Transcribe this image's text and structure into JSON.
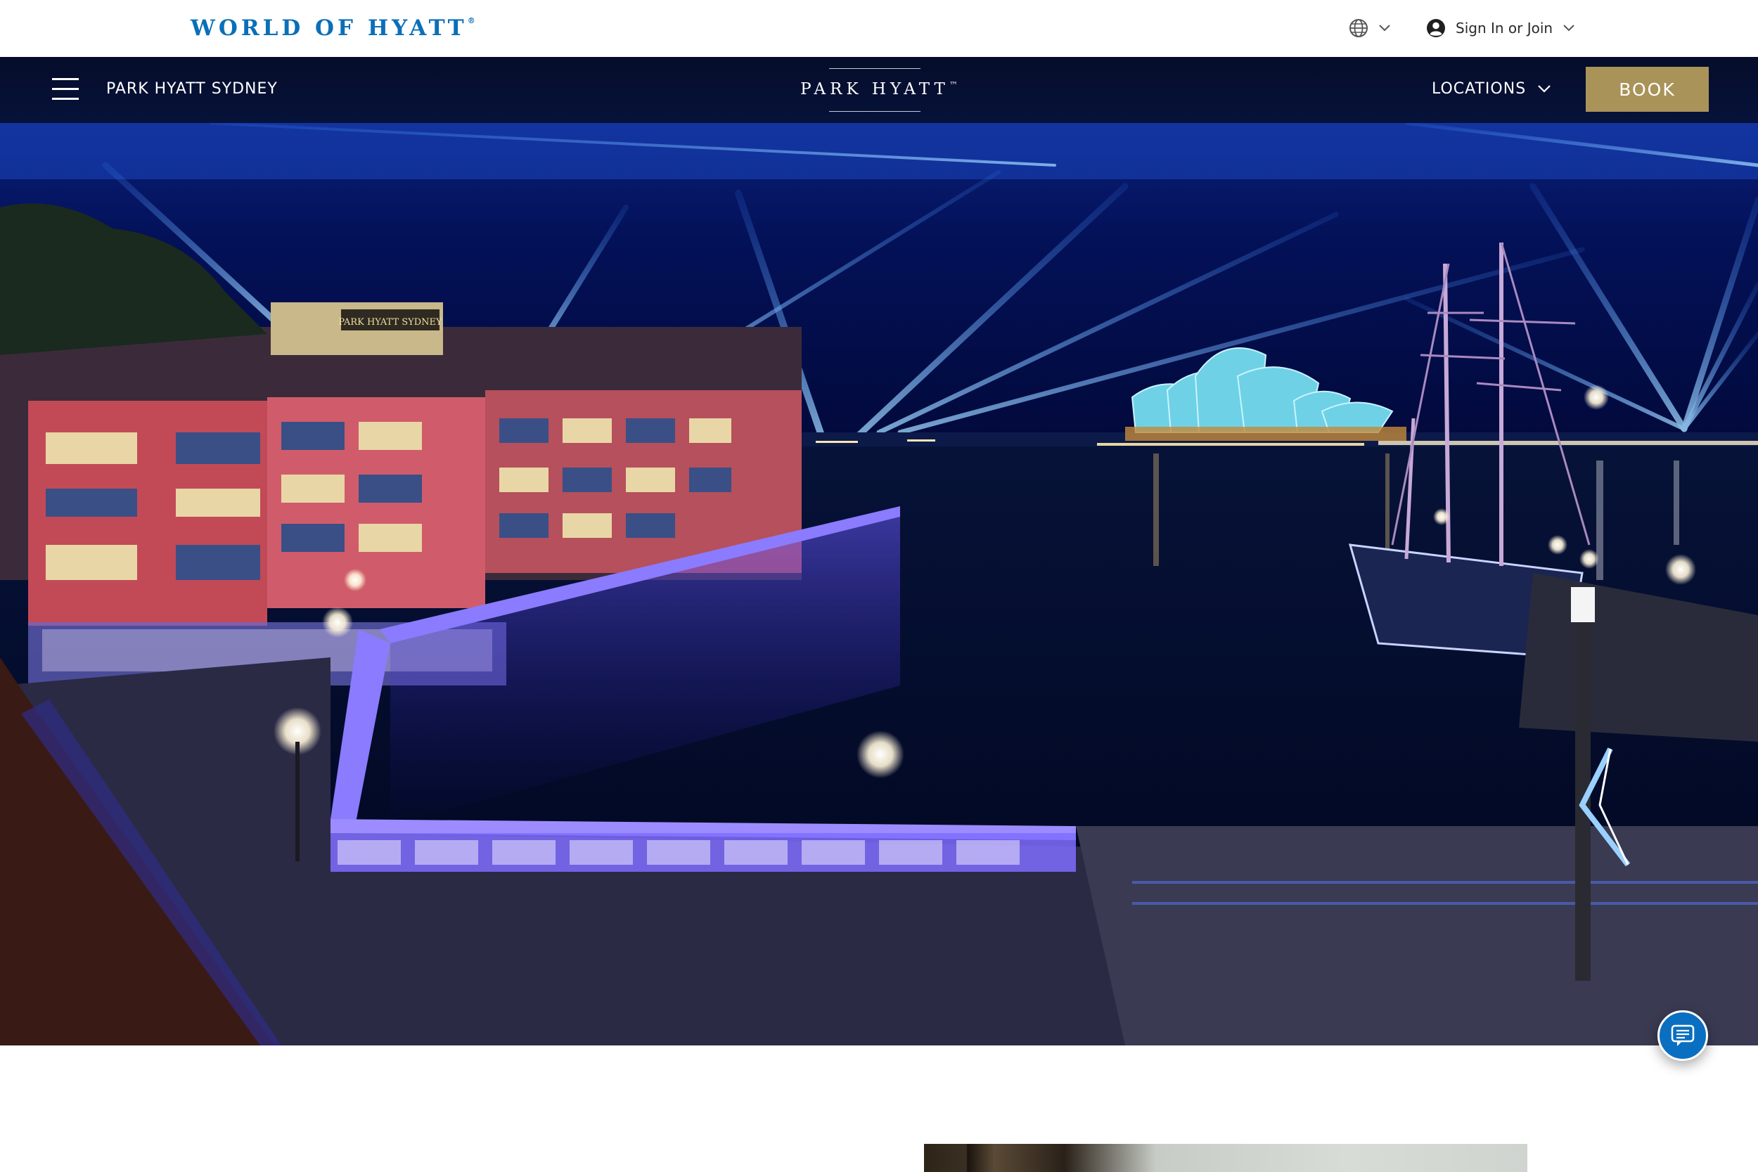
{
  "utility_bar": {
    "logo_text": "WORLD OF HYATT",
    "logo_mark": "®",
    "language_icon": "globe-icon",
    "signin_label": "Sign In or Join",
    "signin_icon": "user-circle-icon",
    "brand_color": "#0b6fb8"
  },
  "property_nav": {
    "menu_icon": "hamburger-menu-icon",
    "property_name": "PARK HYATT SYDNEY",
    "brand_logo": "PARK HYATT",
    "brand_mark": "™",
    "locations_label": "LOCATIONS",
    "book_label": "BOOK",
    "book_color": "#a99358",
    "background_color": "#07123a"
  },
  "hero": {
    "image_description_icon": "hero-photo",
    "sign_on_building": "PARK HYATT SYDNEY"
  },
  "chat": {
    "icon": "chat-bubble-icon",
    "color": "#0a6fc0"
  }
}
